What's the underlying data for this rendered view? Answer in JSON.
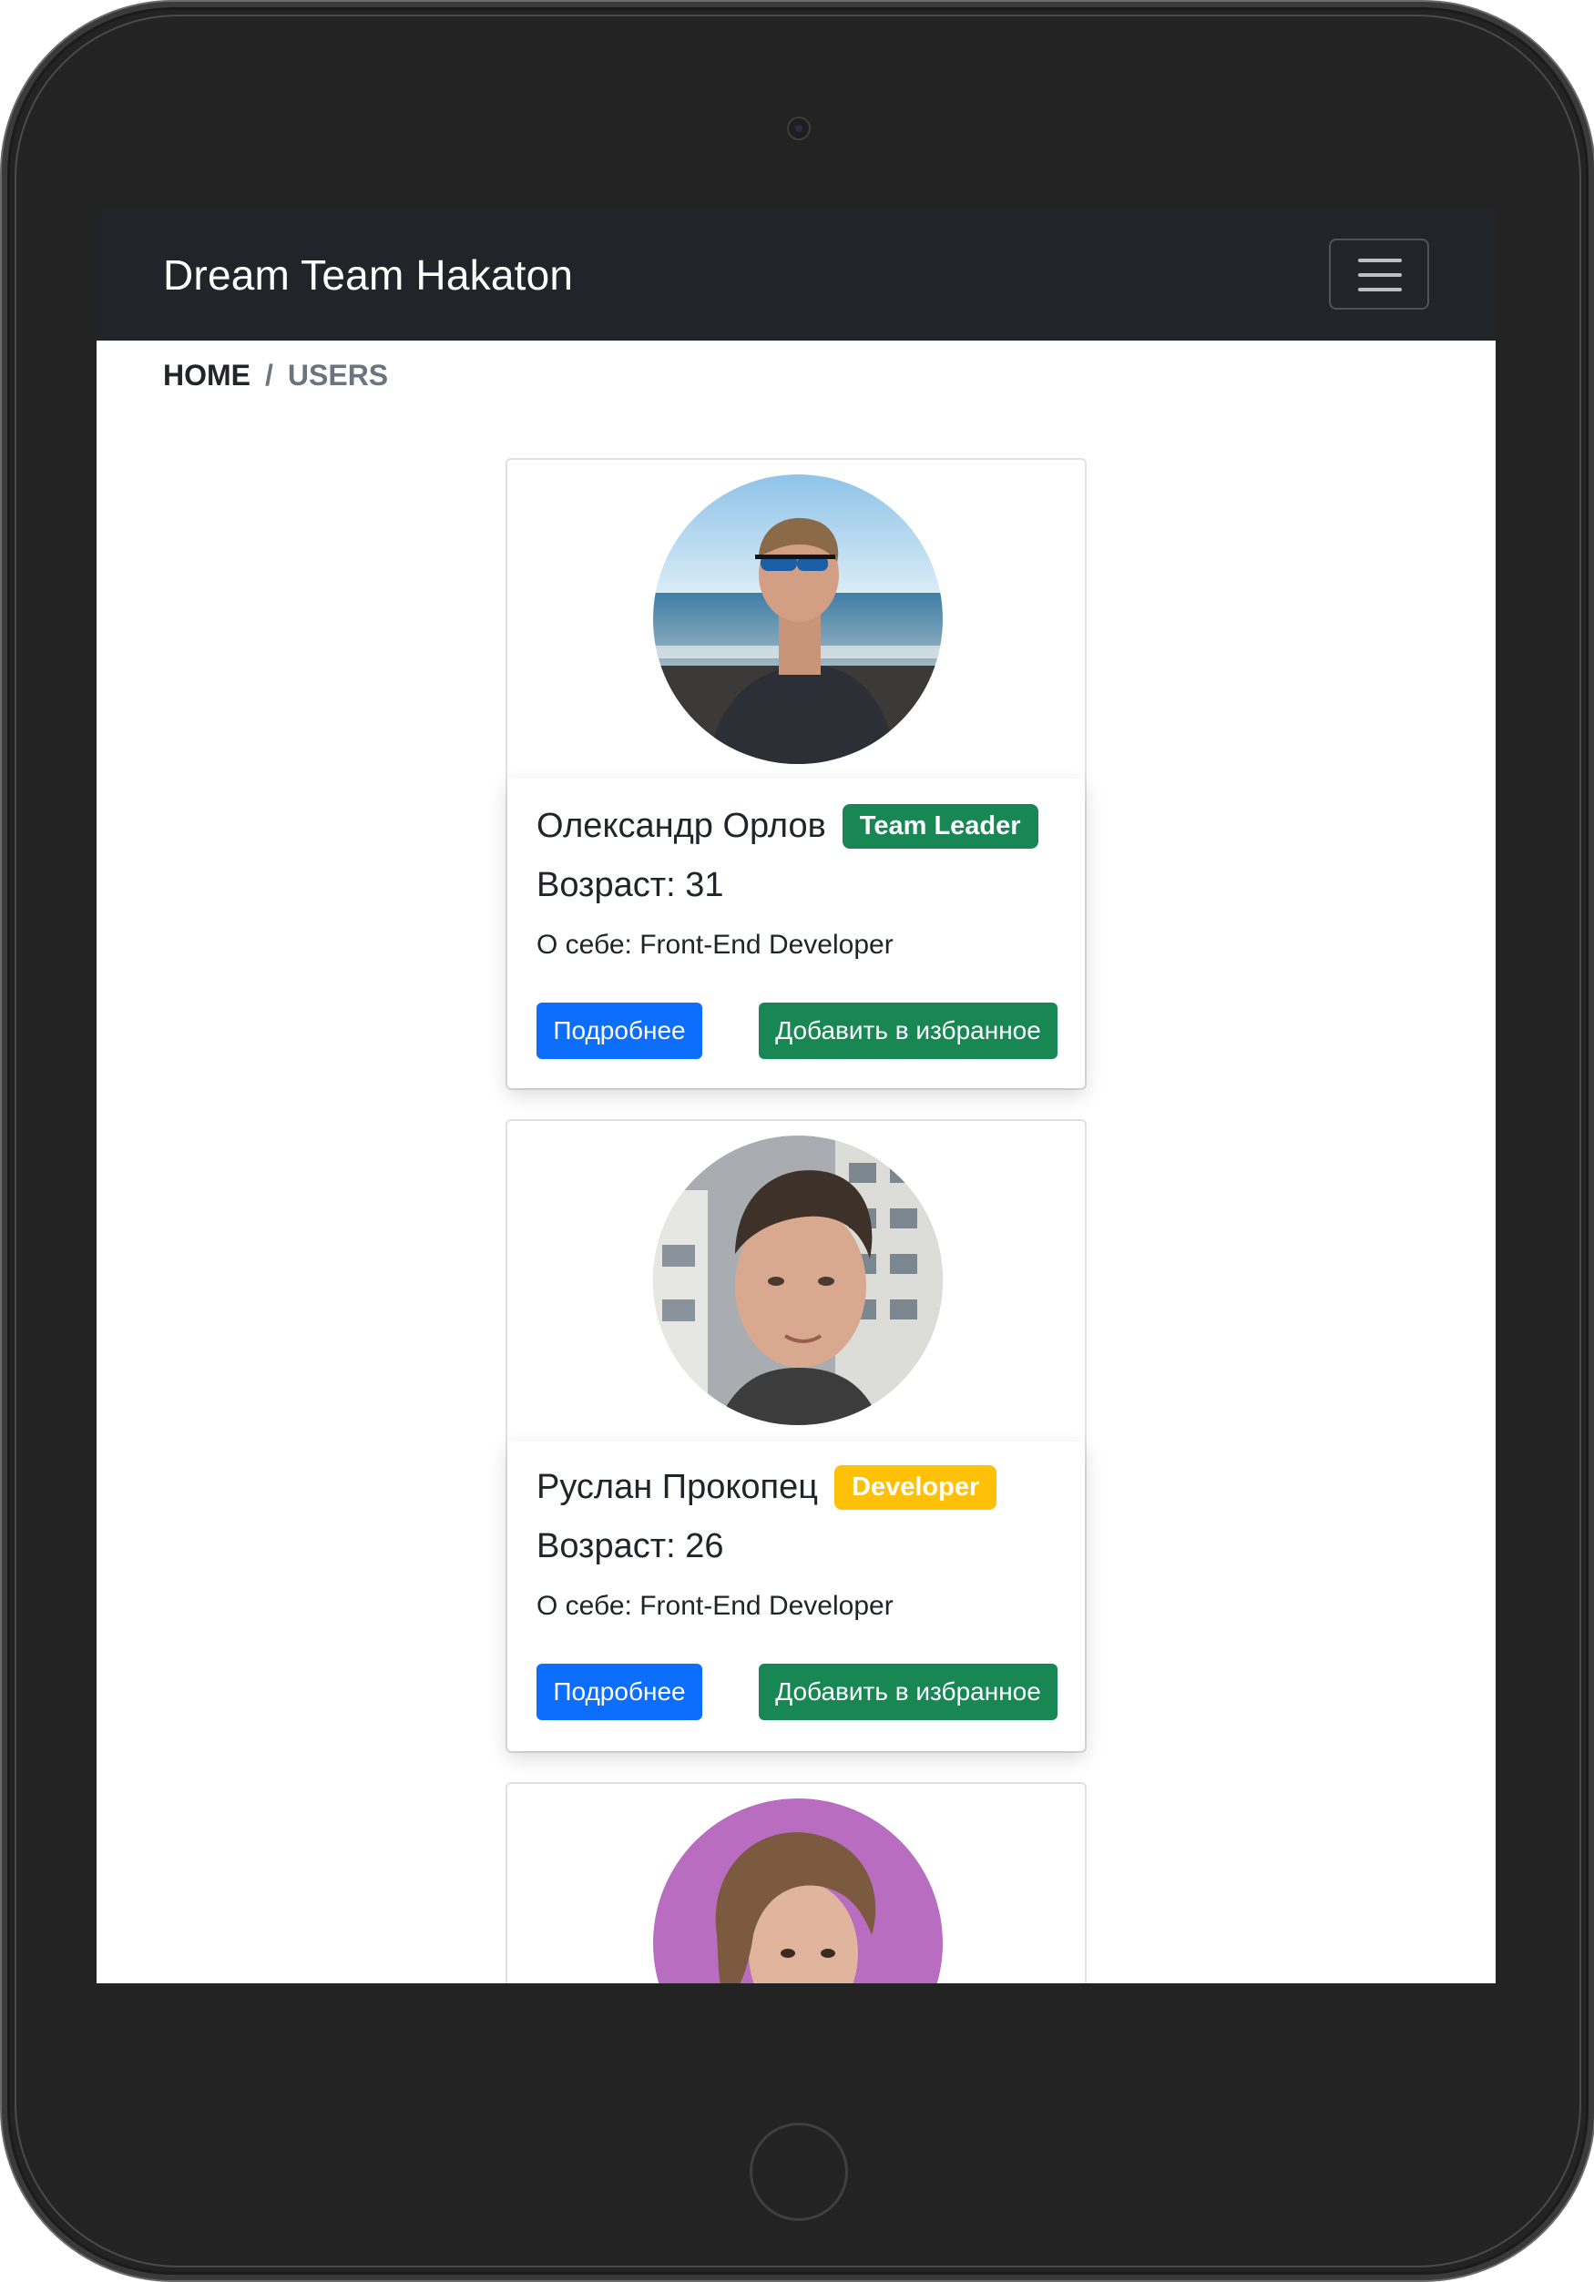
{
  "navbar": {
    "brand": "Dream Team Hakaton"
  },
  "breadcrumb": {
    "home": "HOME",
    "separator": "/",
    "current": "USERS"
  },
  "users": [
    {
      "name": "Олександр Орлов",
      "badge": "Team Leader",
      "badge_color": "#198754",
      "age": "Возраст: 31",
      "about": "О себе: Front-End Developer",
      "details_label": "Подробнее",
      "favorite_label": "Добавить в избранное"
    },
    {
      "name": "Руслан Прокопец",
      "badge": "Developer",
      "badge_color": "#ffc107",
      "age": "Возраст: 26",
      "about": "О себе: Front-End Developer",
      "details_label": "Подробнее",
      "favorite_label": "Добавить в избранное"
    },
    {
      "name": "",
      "badge": "",
      "age": "",
      "about": ""
    }
  ],
  "colors": {
    "navbar_bg": "#212529",
    "primary": "#0d6efd",
    "success": "#198754",
    "warning": "#ffc107"
  }
}
